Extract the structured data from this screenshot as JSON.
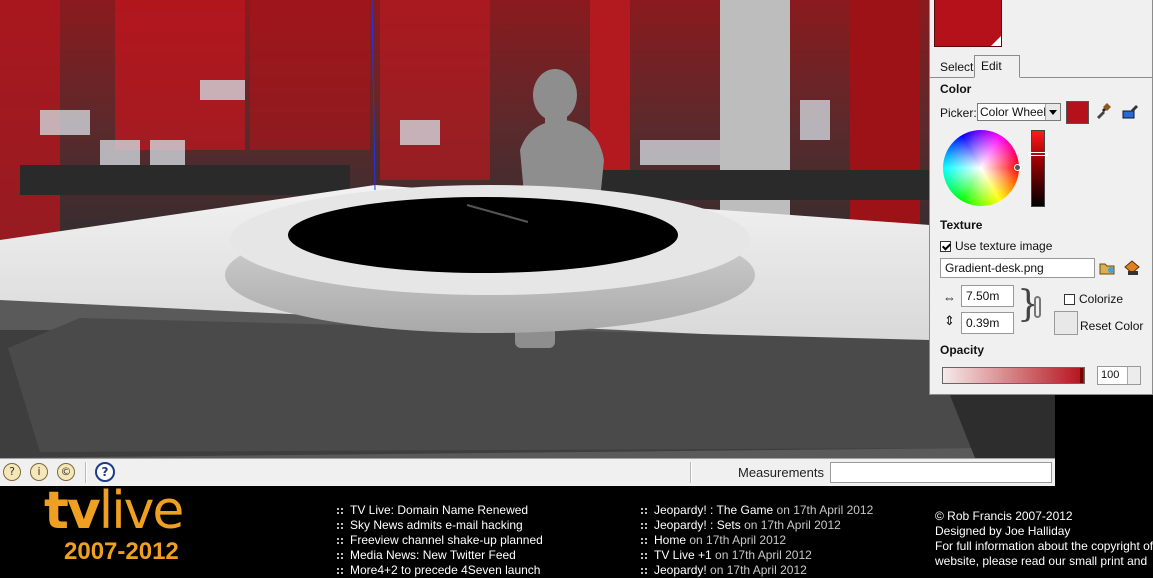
{
  "panel": {
    "tabs": [
      "Select",
      "Edit"
    ],
    "active_tab": "Edit",
    "color_section": "Color",
    "picker_label": "Picker:",
    "picker_value": "Color Wheel",
    "current_color": "#b5111b",
    "texture_section": "Texture",
    "use_texture_label": "Use texture image",
    "use_texture_checked": true,
    "texture_file": "Gradient-desk.png",
    "width_value": "7.50m",
    "height_value": "0.39m",
    "colorize_label": "Colorize",
    "reset_color_label": "Reset Color",
    "opacity_section": "Opacity",
    "opacity_value": "100"
  },
  "statusbar": {
    "measurements_label": "Measurements",
    "measurements_value": "",
    "icons": [
      "geo-location-icon",
      "credits-icon",
      "user-account-icon",
      "help-icon"
    ]
  },
  "footer": {
    "logo_tv": "tv",
    "logo_live": "live",
    "logo_years": "2007-2012",
    "news_left": [
      "TV Live: Domain Name Renewed",
      "Sky News admits e-mail hacking",
      "Freeview channel shake-up planned",
      "Media News: New Twitter Feed",
      "More4+2 to precede 4Seven launch"
    ],
    "news_right": [
      {
        "title": "Jeopardy! : The Game",
        "date": "on 17th April 2012"
      },
      {
        "title": "Jeopardy! : Sets",
        "date": "on 17th April 2012"
      },
      {
        "title": "Home",
        "date": "on 17th April 2012"
      },
      {
        "title": "TV Live +1",
        "date": "on 17th April 2012"
      },
      {
        "title": "Jeopardy!",
        "date": "on 17th April 2012"
      }
    ],
    "info": [
      "© Rob Francis 2007-2012",
      "Designed by Joe Halliday",
      "For full information about the copyright of",
      "website, please read our small print and"
    ]
  }
}
